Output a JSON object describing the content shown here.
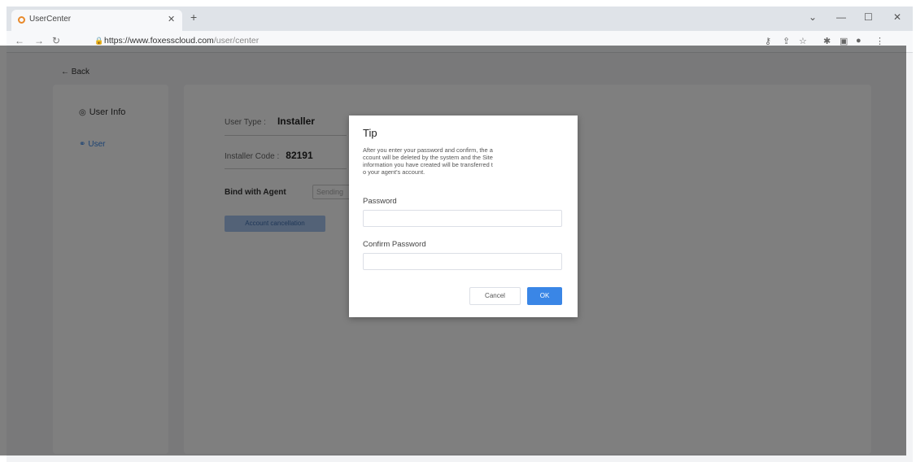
{
  "browser": {
    "tab_title": "UserCenter",
    "url_host": "https://www.foxesscloud.com",
    "url_path": "/user/center"
  },
  "page": {
    "back_label": "← Back",
    "sidebar": {
      "items": [
        {
          "label": "User Info"
        },
        {
          "label": "User"
        }
      ]
    },
    "main": {
      "user_type_label": "User Type :",
      "user_type_value": "Installer",
      "installer_code_label": "Installer Code :",
      "installer_code_value": "82191",
      "bind_agent_label": "Bind with Agent",
      "bind_agent_placeholder": "Sending",
      "account_cancel_button": "Account cancellation"
    }
  },
  "dialog": {
    "title": "Tip",
    "message": "After you enter your password and confirm, the a\nccount will be deleted by the system and the Site\ninformation you have created will be transferred t\no your agent's account.",
    "password_label": "Password",
    "confirm_label": "Confirm Password",
    "cancel_label": "Cancel",
    "ok_label": "OK"
  },
  "colors": {
    "accent": "#3a86e6",
    "overlay": "rgba(0,0,0,0.5)"
  }
}
